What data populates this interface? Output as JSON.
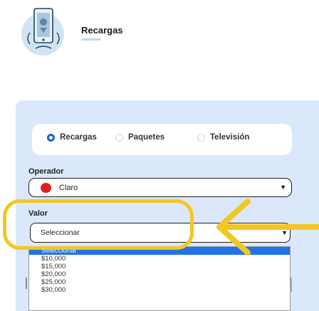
{
  "header": {
    "title": "Recargas",
    "icon": "phone-recharge-icon"
  },
  "tabs": [
    {
      "label": "Recargas",
      "selected": true
    },
    {
      "label": "Paquetes",
      "selected": false
    },
    {
      "label": "Televisión",
      "selected": false
    }
  ],
  "operador": {
    "label": "Operador",
    "value": "Claro",
    "logo": "claro-logo-icon"
  },
  "valor": {
    "label": "Valor",
    "value": "Seleccionar",
    "options": [
      "Seleccionar",
      "$10,000",
      "$15,000",
      "$20,000",
      "$25,000",
      "$30,000"
    ]
  },
  "colors": {
    "accent": "#1565c0",
    "panel": "#dbe8fb",
    "highlight": "#f3c622",
    "claro": "#e01e25"
  }
}
